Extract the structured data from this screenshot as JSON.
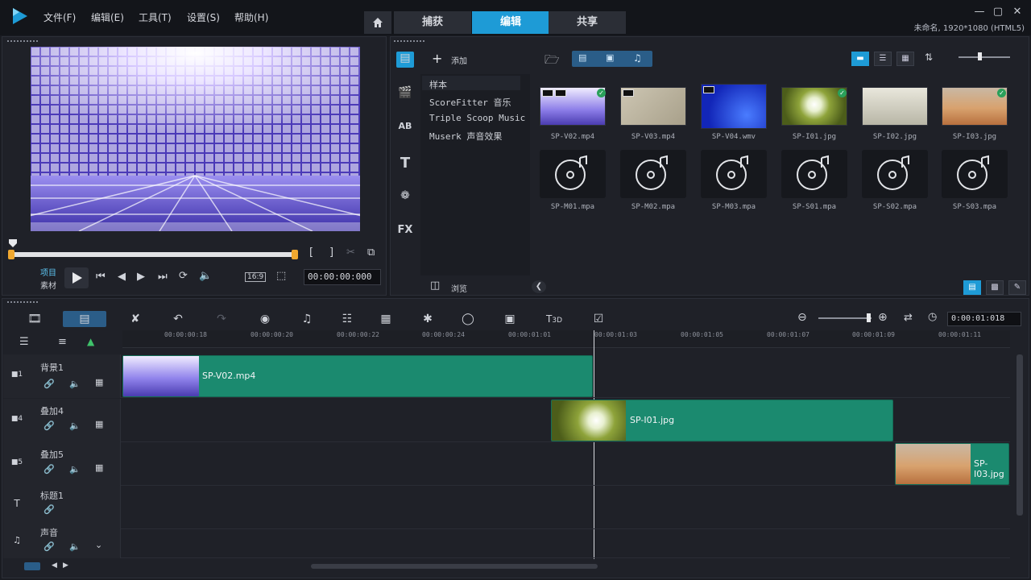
{
  "menu": {
    "file": "文件(F)",
    "edit": "编辑(E)",
    "tools": "工具(T)",
    "settings": "设置(S)",
    "help": "帮助(H)"
  },
  "tabs": {
    "home_icon": "home-icon",
    "capture": "捕获",
    "edit": "编辑",
    "share": "共享"
  },
  "window": {
    "project_info": "未命名, 1920*1080 (HTML5)"
  },
  "preview": {
    "mode_project": "项目",
    "mode_clip": "素材",
    "aspect": "16:9",
    "timecode": "00:00:00:000",
    "mark_in": "[",
    "mark_out": "]"
  },
  "library": {
    "add_label": "添加",
    "browse_label": "浏览",
    "folders": [
      "样本",
      "ScoreFitter 音乐",
      "Triple Scoop Music",
      "Muserk 声音效果"
    ],
    "media": [
      {
        "name": "SP-V02.mp4",
        "kind": "video",
        "checked": true
      },
      {
        "name": "SP-V03.mp4",
        "kind": "video",
        "checked": false
      },
      {
        "name": "SP-V04.wmv",
        "kind": "video",
        "checked": false
      },
      {
        "name": "SP-I01.jpg",
        "kind": "image",
        "checked": true
      },
      {
        "name": "SP-I02.jpg",
        "kind": "image",
        "checked": false
      },
      {
        "name": "SP-I03.jpg",
        "kind": "image",
        "checked": true
      },
      {
        "name": "SP-M01.mpa",
        "kind": "audio",
        "checked": false
      },
      {
        "name": "SP-M02.mpa",
        "kind": "audio",
        "checked": false
      },
      {
        "name": "SP-M03.mpa",
        "kind": "audio",
        "checked": false
      },
      {
        "name": "SP-S01.mpa",
        "kind": "audio",
        "checked": false
      },
      {
        "name": "SP-S02.mpa",
        "kind": "audio",
        "checked": false
      },
      {
        "name": "SP-S03.mpa",
        "kind": "audio",
        "checked": false
      }
    ]
  },
  "timeline": {
    "timecode": "0:00:01:018",
    "ruler": [
      "00:00:00:18",
      "00:00:00:20",
      "00:00:00:22",
      "00:00:00:24",
      "00:00:01:01",
      "00:00:01:03",
      "00:00:01:05",
      "00:00:01:07",
      "00:00:01:09",
      "00:00:01:11"
    ],
    "tracks": [
      {
        "name": "背景1",
        "number": "1"
      },
      {
        "name": "叠加4",
        "number": "4"
      },
      {
        "name": "叠加5",
        "number": "5"
      },
      {
        "name": "标题1",
        "number": "1"
      },
      {
        "name": "声音",
        "number": ""
      }
    ],
    "clips": {
      "bg": "SP-V02.mp4",
      "ov4": "SP-I01.jpg",
      "ov5": "SP-I03.jpg"
    },
    "zoom_label": "3D"
  },
  "colors": {
    "accent": "#1e9bd6",
    "clip": "#1b8a6f",
    "check": "#2aa05a"
  }
}
